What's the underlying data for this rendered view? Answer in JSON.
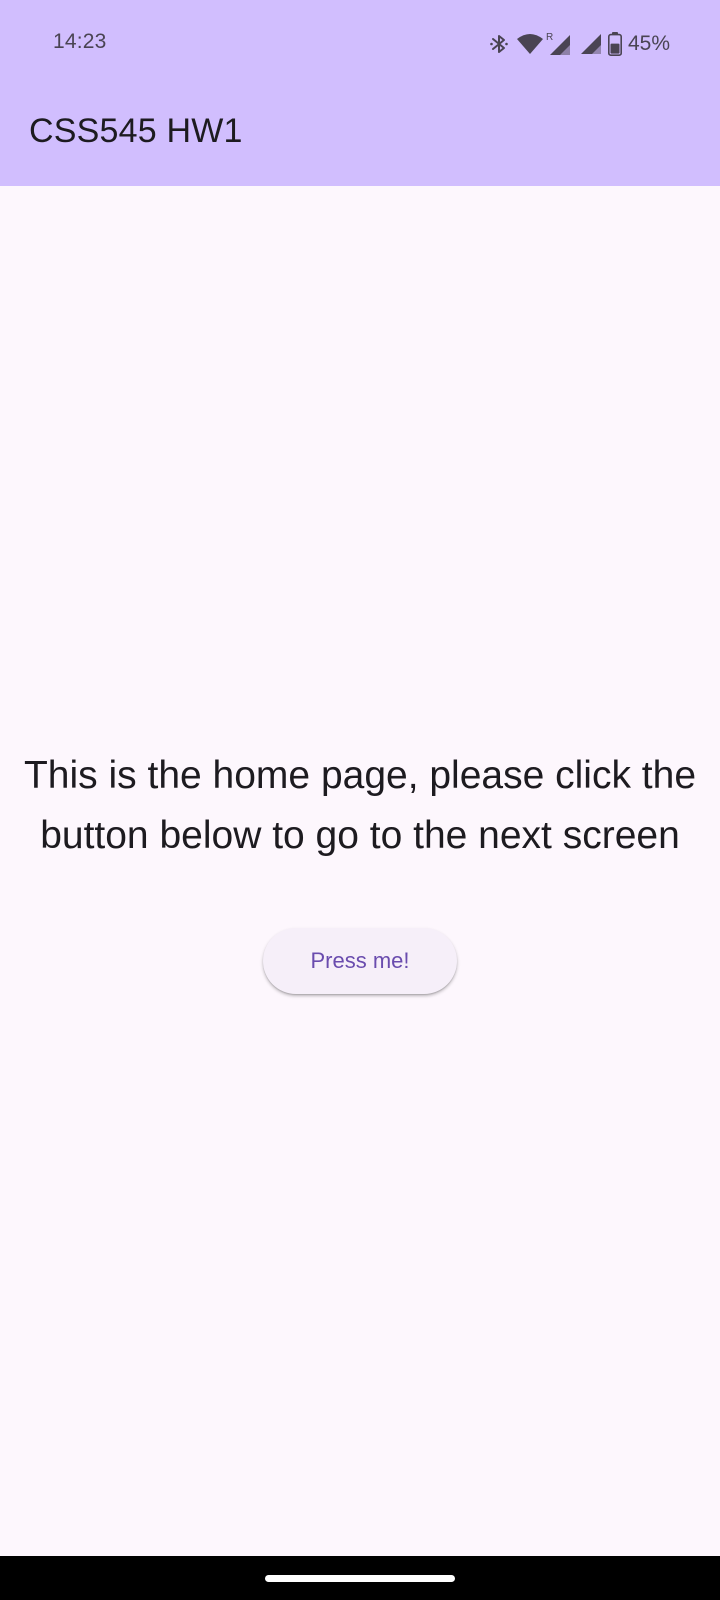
{
  "status_bar": {
    "time": "14:23",
    "battery_percent": "45%",
    "icons": [
      "bluetooth-icon",
      "wifi-icon",
      "signal-roaming-icon",
      "signal-icon",
      "battery-icon"
    ]
  },
  "app_bar": {
    "title": "CSS545 HW1",
    "background": "#d1befe"
  },
  "main": {
    "message": "This is the home page, please click the button below to go to the next screen",
    "button_label": "Press me!"
  },
  "colors": {
    "page_background": "#fdf7fd",
    "button_text": "#6a4cae",
    "button_background": "#f6eff9"
  }
}
